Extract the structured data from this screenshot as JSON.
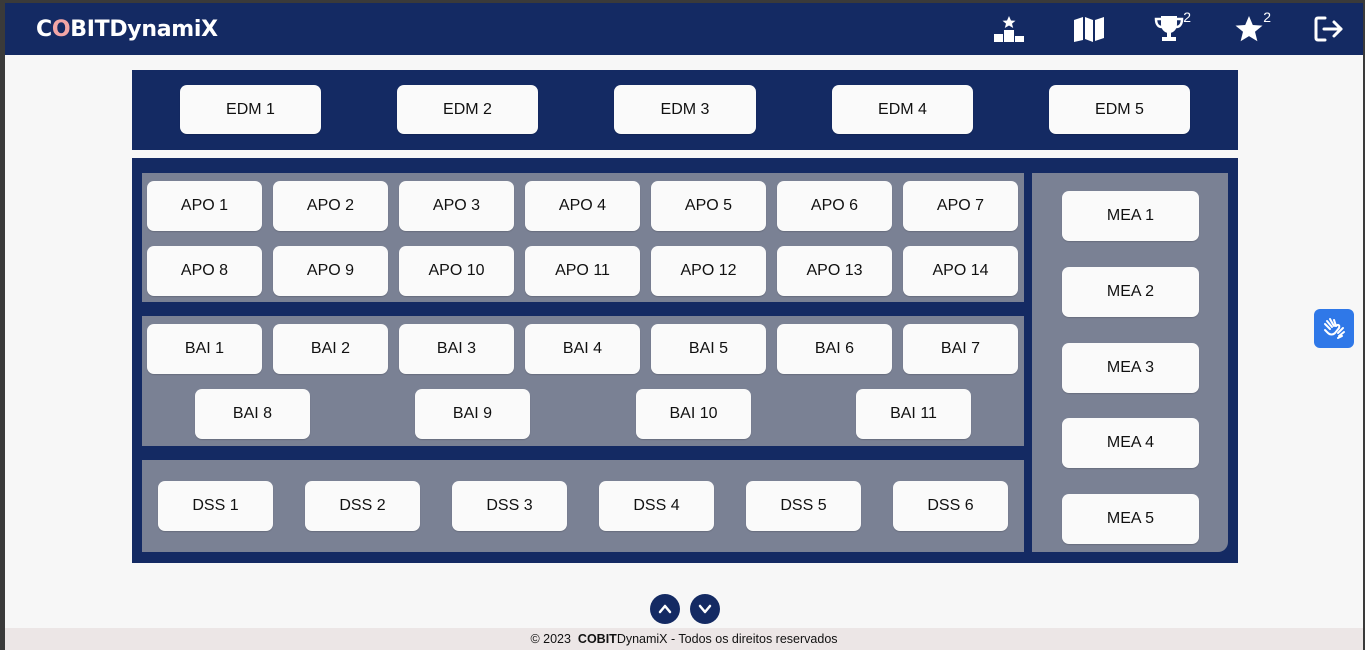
{
  "header": {
    "logo_accent_1": "C",
    "logo_accent_o": "O",
    "logo_rest": "BITDynamiX",
    "icons": [
      "ranking-icon",
      "map-icon",
      "trophy-icon",
      "star-icon",
      "logout-icon"
    ],
    "trophy_count": "2",
    "star_count": "2"
  },
  "edm": [
    "EDM 1",
    "EDM 2",
    "EDM 3",
    "EDM 4",
    "EDM 5"
  ],
  "apo": [
    "APO 1",
    "APO 2",
    "APO 3",
    "APO 4",
    "APO 5",
    "APO 6",
    "APO 7",
    "APO 8",
    "APO 9",
    "APO 10",
    "APO 11",
    "APO 12",
    "APO 13",
    "APO 14"
  ],
  "bai": [
    "BAI 1",
    "BAI 2",
    "BAI 3",
    "BAI 4",
    "BAI 5",
    "BAI 6",
    "BAI 7",
    "BAI 8",
    "BAI 9",
    "BAI 10",
    "BAI 11"
  ],
  "dss": [
    "DSS 1",
    "DSS 2",
    "DSS 3",
    "DSS 4",
    "DSS 5",
    "DSS 6"
  ],
  "mea": [
    "MEA 1",
    "MEA 2",
    "MEA 3",
    "MEA 4",
    "MEA 5"
  ],
  "footer": {
    "copyright": "© 2023",
    "brand_bold": "COBIT",
    "brand_rest": "DynamiX",
    "rights": " - Todos os direitos reservados"
  },
  "colors": {
    "navy": "#142a63",
    "domain_box": "#7a8194",
    "accessibility": "#2f78e8"
  }
}
